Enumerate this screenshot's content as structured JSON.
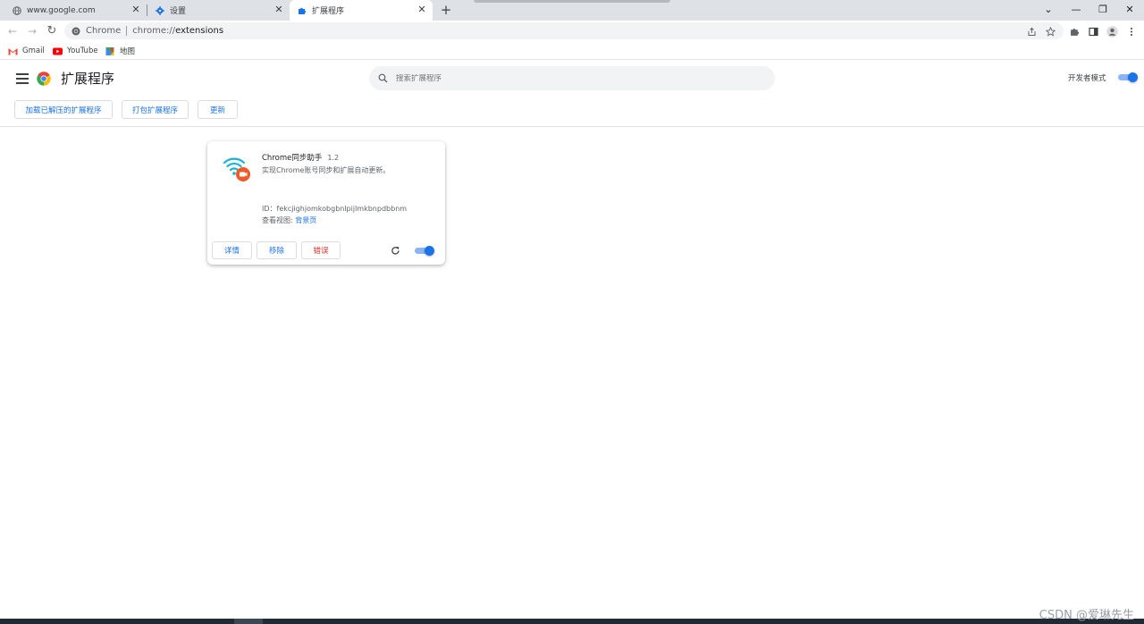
{
  "tabs": [
    {
      "title": "www.google.com",
      "icon": "globe-icon",
      "active": false
    },
    {
      "title": "设置",
      "icon": "gear-icon",
      "active": false
    },
    {
      "title": "扩展程序",
      "icon": "puzzle-icon",
      "active": true
    }
  ],
  "new_tab_glyph": "+",
  "window_controls": {
    "dropdown": "⌄",
    "minimize": "—",
    "restore": "❐",
    "close": "✕"
  },
  "toolbar": {
    "back": "←",
    "forward": "→",
    "reload": "↻",
    "site_label": "Chrome",
    "url_scheme": "chrome://",
    "url_path": "extensions"
  },
  "bookmarks": [
    {
      "label": "Gmail",
      "icon": "gmail-icon"
    },
    {
      "label": "YouTube",
      "icon": "youtube-icon"
    },
    {
      "label": "地图",
      "icon": "maps-icon"
    }
  ],
  "header": {
    "title": "扩展程序",
    "search_placeholder": "搜索扩展程序",
    "developer_mode_label": "开发者模式",
    "developer_mode_on": true,
    "buttons": {
      "load_unpacked": "加载已解压的扩展程序",
      "pack": "打包扩展程序",
      "update": "更新"
    }
  },
  "extension": {
    "name": "Chrome同步助手",
    "version": "1.2",
    "description": "实现Chrome账号同步和扩展自动更新。",
    "id_line": "ID：fekcjighjomkobgbnlpijlmkbnpdbbnm",
    "views_label": "查看视图: ",
    "views_link": "背景页",
    "buttons": {
      "details": "详情",
      "remove": "移除",
      "errors": "错误"
    },
    "enabled": true,
    "icon": "wifi-sync-icon"
  },
  "watermark": "CSDN @爱琳先生",
  "colors": {
    "accent": "#1a73e8",
    "toggle_track": "#8ab4f8",
    "error": "#d93025",
    "tabstrip": "#dee1e6",
    "extension_icon_cyan": "#18b3d6",
    "extension_icon_orange": "#f05a28"
  }
}
